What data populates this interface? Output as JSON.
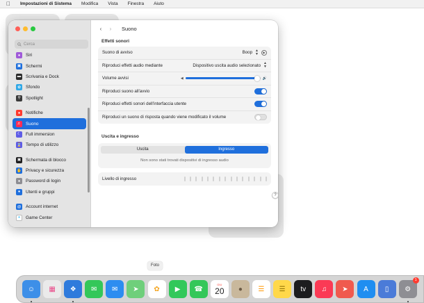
{
  "menubar": {
    "app": "Impostazioni di Sistema",
    "items": [
      "Modifica",
      "Vista",
      "Finestra",
      "Aiuto"
    ]
  },
  "sidebar": {
    "search_placeholder": "Cerca",
    "items": [
      {
        "label": "Siri",
        "icon": "siri-icon",
        "color": "#a05ad9"
      },
      {
        "label": "Schermi",
        "icon": "display-icon",
        "color": "#1f6fdc"
      },
      {
        "label": "Scrivania e Dock",
        "icon": "dock-icon",
        "color": "#2b2b2b"
      },
      {
        "label": "Sfondo",
        "icon": "wallpaper-icon",
        "color": "#31a8e6"
      },
      {
        "label": "Spotlight",
        "icon": "spotlight-icon",
        "color": "#3a3a3a"
      },
      {
        "label": "Notifiche",
        "icon": "notifications-icon",
        "color": "#ff3b30"
      },
      {
        "label": "Suono",
        "icon": "sound-icon",
        "color": "#ff2d55",
        "selected": true
      },
      {
        "label": "Full immersion",
        "icon": "focus-icon",
        "color": "#5e5ce6"
      },
      {
        "label": "Tempo di utilizzo",
        "icon": "screentime-icon",
        "color": "#5e5ce6"
      },
      {
        "label": "Schermata di blocco",
        "icon": "lockscreen-icon",
        "color": "#1d1d1f"
      },
      {
        "label": "Privacy e sicurezza",
        "icon": "privacy-icon",
        "color": "#1f6fdc"
      },
      {
        "label": "Password di login",
        "icon": "password-icon",
        "color": "#8e8e93"
      },
      {
        "label": "Utenti e gruppi",
        "icon": "users-icon",
        "color": "#1f6fdc"
      },
      {
        "label": "Account internet",
        "icon": "internet-accounts-icon",
        "color": "#1f6fdc"
      },
      {
        "label": "Game Center",
        "icon": "game-center-icon",
        "color": "#ffffff"
      }
    ]
  },
  "pane": {
    "title": "Suono",
    "effects_title": "Effetti sonori",
    "alert_sound_label": "Suono di avviso",
    "alert_sound_value": "Boop",
    "play_effects_label": "Riproduci effetti audio mediante",
    "play_effects_value": "Dispositivo uscita audio selezionato",
    "alert_volume_label": "Volume avvisi",
    "alert_volume_level": 0.96,
    "startup_label": "Riproduci suono all'avvio",
    "startup_on": true,
    "ui_effects_label": "Riproduci effetti sonori dell'interfaccia utente",
    "ui_effects_on": true,
    "feedback_label": "Riproduci un suono di risposta quando viene modificato il volume",
    "feedback_on": false,
    "io_title": "Uscita e ingresso",
    "tab_output": "Uscita",
    "tab_input": "Ingresso",
    "active_tab": "input",
    "no_devices": "Non sono stati trovati dispositivi di ingresso audio",
    "input_level_label": "Livello di ingresso",
    "input_level_bars": 15,
    "help": "?"
  },
  "dock_tooltip": "Foto",
  "dock": {
    "calendar_month": "GIU",
    "calendar_day": "20",
    "settings_badge": "1",
    "apps": [
      {
        "name": "finder-icon",
        "color": "#3d8fe8",
        "running": true
      },
      {
        "name": "launchpad-icon",
        "color": "#eaeaea",
        "running": false
      },
      {
        "name": "safari-icon",
        "color": "#2f7bdc",
        "running": true
      },
      {
        "name": "messages-icon",
        "color": "#34c759",
        "running": false
      },
      {
        "name": "mail-icon",
        "color": "#2d8df0",
        "running": false
      },
      {
        "name": "maps-icon",
        "color": "#6fcf7b",
        "running": false
      },
      {
        "name": "photos-icon",
        "color": "#ffffff",
        "running": false
      },
      {
        "name": "facetime-icon",
        "color": "#32c85a",
        "running": false
      },
      {
        "name": "phone-icon",
        "color": "#34c759",
        "running": false
      },
      {
        "name": "calendar-icon",
        "color": "#ffffff",
        "running": false
      },
      {
        "name": "contacts-icon",
        "color": "#c9b89c",
        "running": false
      },
      {
        "name": "reminders-icon",
        "color": "#ffffff",
        "running": false
      },
      {
        "name": "notes-icon",
        "color": "#ffd84a",
        "running": false
      },
      {
        "name": "tv-icon",
        "color": "#1d1d1f",
        "running": false
      },
      {
        "name": "music-icon",
        "color": "#fb3a55",
        "running": false
      },
      {
        "name": "rocket-icon",
        "color": "#f05a4e",
        "running": false
      },
      {
        "name": "app-store-icon",
        "color": "#1f8ef1",
        "running": false
      },
      {
        "name": "iphone-mirroring-icon",
        "color": "#4b7bd8",
        "running": false
      },
      {
        "name": "system-settings-icon",
        "color": "#8e8e93",
        "running": true
      }
    ]
  }
}
